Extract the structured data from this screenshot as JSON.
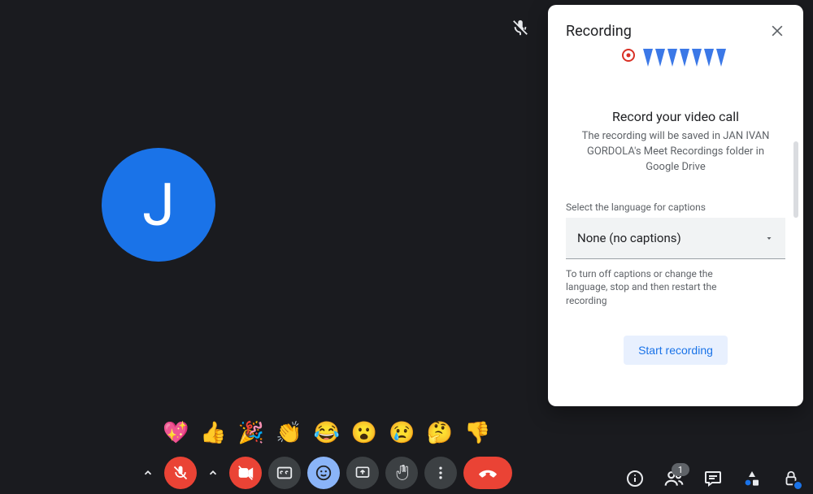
{
  "avatar": {
    "letter": "J"
  },
  "reactions": [
    "💖",
    "👍",
    "🎉",
    "👏",
    "😂",
    "😮",
    "😢",
    "🤔",
    "👎"
  ],
  "panel": {
    "title": "Recording",
    "heading": "Record your video call",
    "subheading": "The recording will be saved in JAN IVAN GORDOLA's Meet Recordings folder in Google Drive",
    "caption_label": "Select the language for captions",
    "caption_value": "None (no captions)",
    "caption_hint": "To turn off captions or change the language, stop and then restart the recording",
    "start_label": "Start recording"
  },
  "participants_badge": "1"
}
